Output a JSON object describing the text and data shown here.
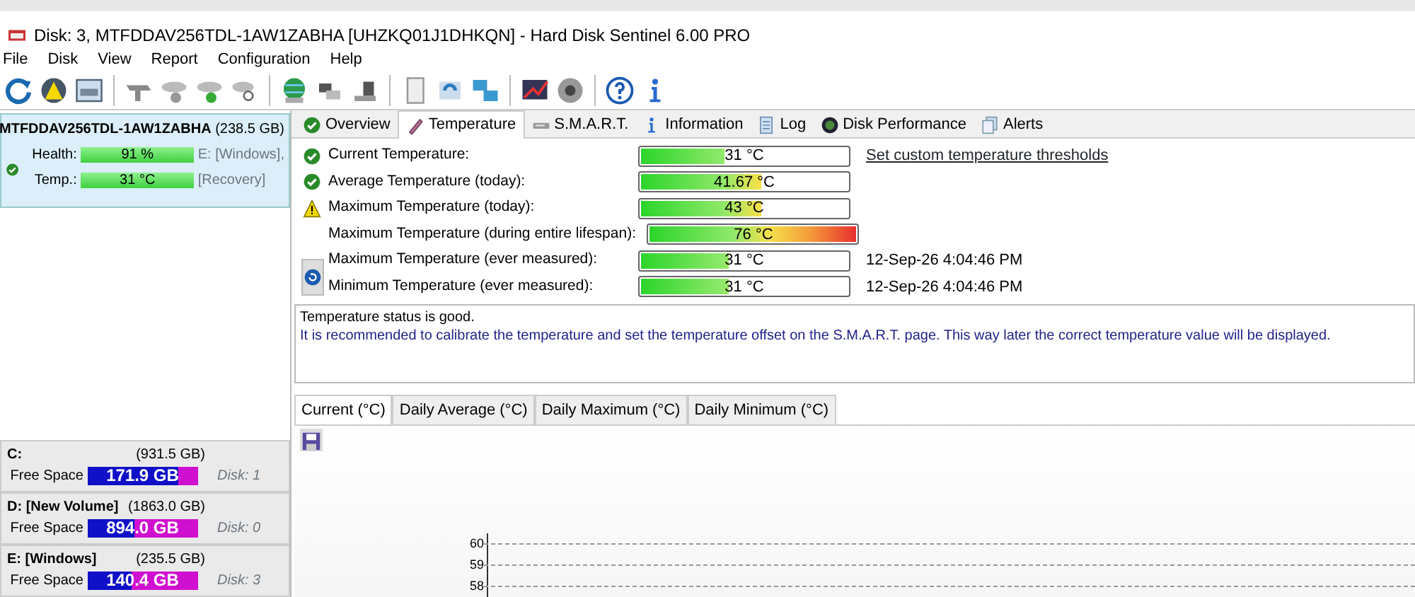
{
  "window": {
    "title": "Disk: 3, MTFDDAV256TDL-1AW1ZABHA [UHZKQ01J1DHKQN]  -  Hard Disk Sentinel 6.00 PRO"
  },
  "menu": [
    "File",
    "Disk",
    "View",
    "Report",
    "Configuration",
    "Help"
  ],
  "disk": {
    "name": "MTFDDAV256TDL-1AW1ZABHA",
    "size": "(238.5 GB)",
    "selected": true,
    "metrics": [
      {
        "label": "Health:",
        "value": "91 %",
        "level": 1,
        "note": "E: [Windows],"
      },
      {
        "label": "Temp.:",
        "value": "31 °C",
        "level": 1,
        "note": "[Recovery]"
      }
    ]
  },
  "volumes": [
    {
      "name": "C:",
      "size": "(931.5 GB)",
      "label": "Free Space",
      "free": "171.9 GB",
      "level": 0.83,
      "disk": "Disk: 1"
    },
    {
      "name": "D: [New Volume]",
      "size": "(1863.0 GB)",
      "label": "Free Space",
      "free": "894.0 GB",
      "level": 0.42,
      "disk": "Disk: 0"
    },
    {
      "name": "E: [Windows]",
      "size": "(235.5 GB)",
      "label": "Free Space",
      "free": "140.4 GB",
      "level": 0.4,
      "disk": "Disk: 3"
    }
  ],
  "tabs": [
    {
      "label": "Overview",
      "kind": "ok",
      "selected": false
    },
    {
      "label": "Temperature",
      "kind": "thermo",
      "selected": true
    },
    {
      "label": "S.M.A.R.T.",
      "kind": "disk",
      "selected": false
    },
    {
      "label": "Information",
      "kind": "info",
      "selected": false
    },
    {
      "label": "Log",
      "kind": "log",
      "selected": false
    },
    {
      "label": "Disk Performance",
      "kind": "gauge",
      "selected": false
    },
    {
      "label": "Alerts",
      "kind": "doc",
      "selected": false
    }
  ],
  "temperatures": [
    {
      "label": "Current Temperature:",
      "kind": "ok",
      "value": "31 °C",
      "level": 0.41
    },
    {
      "label": "Average Temperature (today):",
      "kind": "ok",
      "value": "41.67 °C",
      "level": 0.59
    },
    {
      "label": "Maximum Temperature (today):",
      "kind": "warning",
      "value": "43 °C",
      "level": 0.59
    },
    {
      "label": "Maximum Temperature (during entire lifespan):",
      "kind": "plain",
      "value": "76 °C",
      "level": 1
    },
    {
      "label": "Maximum Temperature (ever measured):",
      "kind": "plain",
      "value": "31 °C",
      "level": 0.43,
      "time": "12-Sep-26 4:04:46 PM"
    },
    {
      "label": "Minimum Temperature (ever measured):",
      "kind": "plain",
      "value": "31 °C",
      "level": 0.43,
      "time": "12-Sep-26 4:04:46 PM"
    }
  ],
  "threshold_link": "Set custom temperature thresholds",
  "status_text": {
    "line_1": "Temperature status is good.",
    "line_2": "It is recommended to calibrate the temperature and set the temperature offset on the S.M.A.R.T. page. This way later the correct temperature value will be displayed."
  },
  "chart_tabs": [
    {
      "label": "Current (°C)",
      "selected": true
    },
    {
      "label": "Daily Average (°C)",
      "selected": false
    },
    {
      "label": "Daily Maximum (°C)",
      "selected": false
    },
    {
      "label": "Daily Minimum (°C)",
      "selected": false
    }
  ],
  "chart": {
    "y_tick_labels": [
      "60",
      "59",
      "58"
    ]
  }
}
